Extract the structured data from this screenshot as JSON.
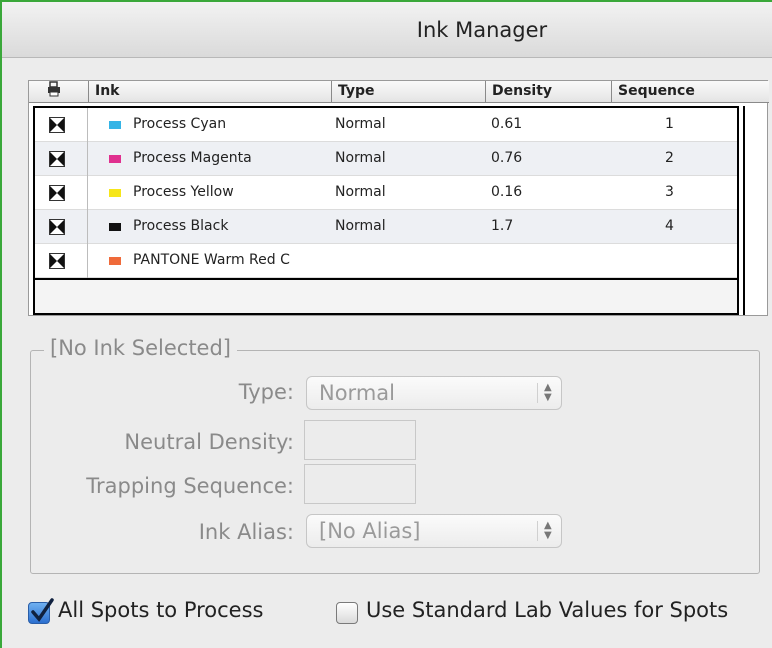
{
  "window": {
    "title": "Ink Manager"
  },
  "table": {
    "columns": {
      "print_icon": "print-all-icon",
      "ink": "Ink",
      "type": "Type",
      "density": "Density",
      "sequence": "Sequence"
    },
    "rows": [
      {
        "ink": "Process Cyan",
        "type": "Normal",
        "density": "0.61",
        "sequence": "1",
        "swatch_color": "#35b4e6",
        "icon": "process-ink-icon"
      },
      {
        "ink": "Process Magenta",
        "type": "Normal",
        "density": "0.76",
        "sequence": "2",
        "swatch_color": "#e0308f",
        "icon": "process-ink-icon"
      },
      {
        "ink": "Process Yellow",
        "type": "Normal",
        "density": "0.16",
        "sequence": "3",
        "swatch_color": "#f6e61a",
        "icon": "process-ink-icon"
      },
      {
        "ink": "Process Black",
        "type": "Normal",
        "density": "1.7",
        "sequence": "4",
        "swatch_color": "#111111",
        "icon": "process-ink-icon"
      },
      {
        "ink": "PANTONE Warm Red C",
        "type": "",
        "density": "",
        "sequence": "",
        "swatch_color": "#ef6a3a",
        "icon": "process-ink-icon"
      }
    ]
  },
  "details": {
    "group_title": "[No Ink Selected]",
    "type_label": "Type:",
    "type_value": "Normal",
    "neutral_density_label": "Neutral Density:",
    "neutral_density_value": "",
    "trapping_sequence_label": "Trapping Sequence:",
    "trapping_sequence_value": "",
    "ink_alias_label": "Ink Alias:",
    "ink_alias_value": "[No Alias]"
  },
  "options": {
    "all_spots_to_process": {
      "label": "All Spots to Process",
      "checked": true
    },
    "use_standard_lab": {
      "label": "Use Standard Lab Values for Spots",
      "checked": false
    }
  },
  "colors": {
    "accent": "#3aa83a",
    "checkbox_blue": "#2c6fd0"
  }
}
